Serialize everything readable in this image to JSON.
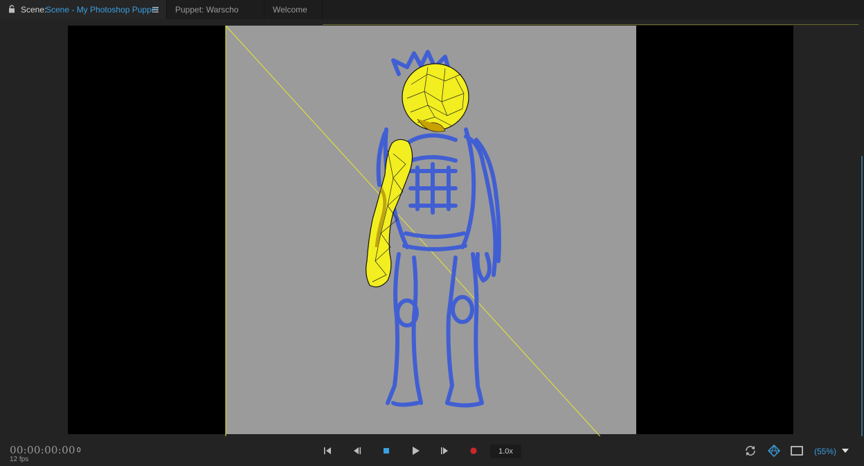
{
  "tabs": {
    "scene_prefix": "Scene:",
    "scene_name": "Scene - My Photoshop Puppet",
    "puppet": "Puppet: Warscho",
    "welcome": "Welcome"
  },
  "icons": {
    "lock": "lock-icon",
    "panel_menu": "hamburger-menu-icon",
    "go_to_start": "skip-to-start-icon",
    "step_back": "step-back-icon",
    "stop": "stop-icon",
    "play": "play-icon",
    "step_forward": "step-forward-icon",
    "record": "record-icon",
    "refresh": "refresh-icon",
    "mesh_toggle": "mesh-icon",
    "frame_toggle": "frame-icon",
    "zoom_dropdown": "chevron-down-icon"
  },
  "transport": {
    "timecode": "00:00:00:00",
    "fps": "12 fps",
    "frame": "0",
    "rate": "1.0x",
    "zoom": "(55%)"
  },
  "colors": {
    "accent": "#3a9fe0",
    "mesh": "#ffff00",
    "sketch": "#3a5ad8",
    "record": "#c8282a",
    "stage": "#9b9b9b"
  }
}
